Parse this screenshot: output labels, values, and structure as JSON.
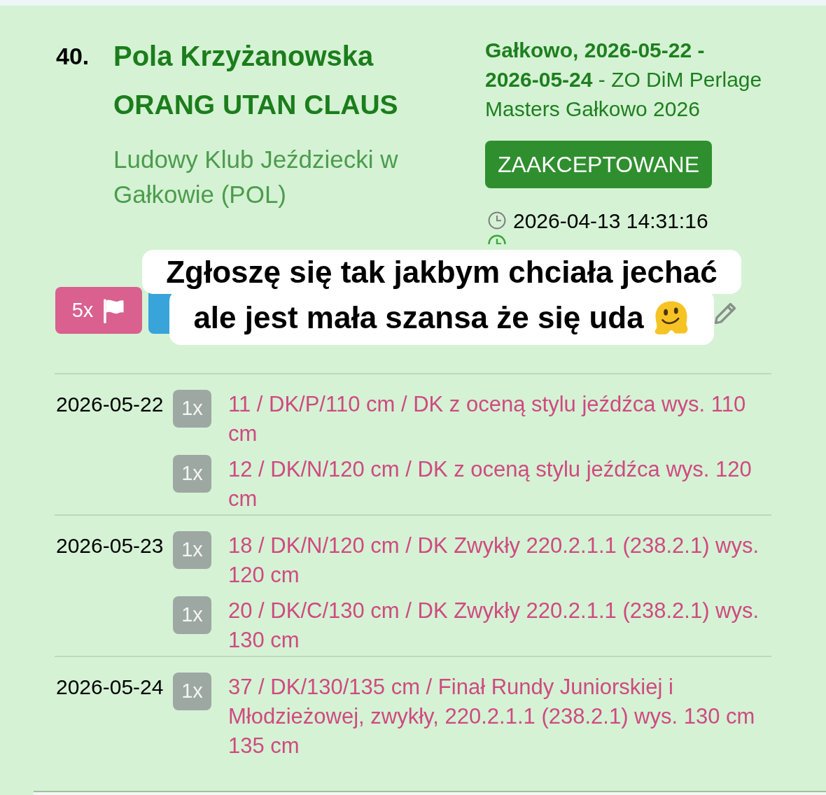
{
  "entry": {
    "number": "40.",
    "rider": "Pola Krzyżanowska",
    "horse": "ORANG UTAN CLAUS",
    "club": "Ludowy Klub Jeździecki w Gałkowie (POL)"
  },
  "event": {
    "info": "**Gałkowo, 2026-05-22 - 2026-05-24** - ZO DiM Perlage Masters Gałkowo 2026",
    "status": "ZAAKCEPTOWANE",
    "clocks": [
      {
        "color": "#7f7f7f",
        "time": "2026-04-13 14:31:16"
      },
      {
        "color": "#3aa63a"
      }
    ]
  },
  "badges": [
    {
      "kind": "count",
      "label": "5x",
      "color": "#d9608f"
    },
    {
      "kind": "tile",
      "color": "#38a4da"
    }
  ],
  "caption": {
    "lines": [
      "Zgłoszę się tak jakbym chciała jechać",
      "ale jest mała szansa że się uda"
    ]
  },
  "days": [
    {
      "date": "2026-05-22",
      "classes": [
        {
          "count": "1x",
          "name": "11 / DK/P/110 cm / DK z oceną stylu jeźdźca wys. 110 cm"
        },
        {
          "count": "1x",
          "name": "12 / DK/N/120 cm / DK z oceną stylu jeźdźca wys. 120 cm"
        }
      ]
    },
    {
      "date": "2026-05-23",
      "classes": [
        {
          "count": "1x",
          "name": "18 / DK/N/120 cm / DK Zwykły 220.2.1.1 (238.2.1) wys. 120 cm"
        },
        {
          "count": "1x",
          "name": "20 / DK/C/130 cm / DK Zwykły 220.2.1.1 (238.2.1) wys. 130 cm"
        }
      ]
    },
    {
      "date": "2026-05-24",
      "classes": [
        {
          "count": "1x",
          "name": "37 / DK/130/135 cm / Finał Rundy Juniorskiej i Młodzieżowej, zwykły, 220.2.1.1 (238.2.1) wys. 130 cm 135 cm"
        }
      ]
    }
  ]
}
